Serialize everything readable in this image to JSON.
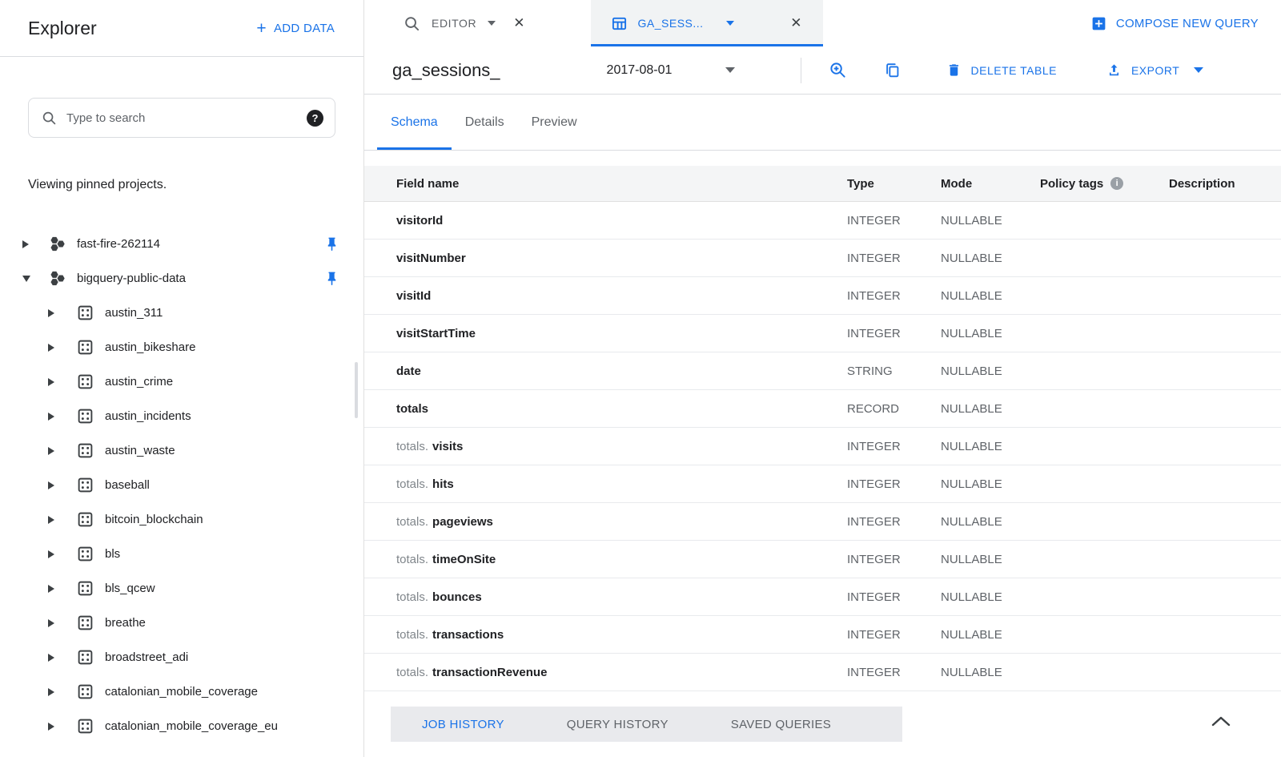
{
  "colors": {
    "accent": "#1a73e8"
  },
  "icons": {
    "add": "+",
    "close": "✕",
    "help": "?",
    "info": "i"
  },
  "explorer": {
    "title": "Explorer",
    "add_data": "ADD DATA",
    "search": {
      "placeholder": "Type to search"
    },
    "pinned_note": "Viewing pinned projects.",
    "projects": [
      {
        "label": "fast-fire-262114",
        "expanded": false,
        "pinned": true,
        "datasets": []
      },
      {
        "label": "bigquery-public-data",
        "expanded": true,
        "pinned": true,
        "datasets": [
          "austin_311",
          "austin_bikeshare",
          "austin_crime",
          "austin_incidents",
          "austin_waste",
          "baseball",
          "bitcoin_blockchain",
          "bls",
          "bls_qcew",
          "breathe",
          "broadstreet_adi",
          "catalonian_mobile_coverage",
          "catalonian_mobile_coverage_eu"
        ]
      }
    ]
  },
  "tab_bar": {
    "editor_tab": {
      "label": "EDITOR"
    },
    "table_tab": {
      "label": "GA_SESS..."
    },
    "compose_button": "COMPOSE NEW QUERY"
  },
  "toolbar": {
    "table_name": "ga_sessions_",
    "table_suffix": "2017-08-01",
    "delete_table": "DELETE TABLE",
    "export": "EXPORT"
  },
  "view_tabs": {
    "labels": [
      "Schema",
      "Details",
      "Preview"
    ],
    "active_index": 0
  },
  "schema": {
    "columns": [
      "Field name",
      "Type",
      "Mode",
      "Policy tags",
      "Description"
    ],
    "rows": [
      {
        "prefix": "",
        "name": "visitorId",
        "type": "INTEGER",
        "mode": "NULLABLE"
      },
      {
        "prefix": "",
        "name": "visitNumber",
        "type": "INTEGER",
        "mode": "NULLABLE"
      },
      {
        "prefix": "",
        "name": "visitId",
        "type": "INTEGER",
        "mode": "NULLABLE"
      },
      {
        "prefix": "",
        "name": "visitStartTime",
        "type": "INTEGER",
        "mode": "NULLABLE"
      },
      {
        "prefix": "",
        "name": "date",
        "type": "STRING",
        "mode": "NULLABLE"
      },
      {
        "prefix": "",
        "name": "totals",
        "type": "RECORD",
        "mode": "NULLABLE"
      },
      {
        "prefix": "totals.",
        "name": "visits",
        "type": "INTEGER",
        "mode": "NULLABLE"
      },
      {
        "prefix": "totals.",
        "name": "hits",
        "type": "INTEGER",
        "mode": "NULLABLE"
      },
      {
        "prefix": "totals.",
        "name": "pageviews",
        "type": "INTEGER",
        "mode": "NULLABLE"
      },
      {
        "prefix": "totals.",
        "name": "timeOnSite",
        "type": "INTEGER",
        "mode": "NULLABLE"
      },
      {
        "prefix": "totals.",
        "name": "bounces",
        "type": "INTEGER",
        "mode": "NULLABLE"
      },
      {
        "prefix": "totals.",
        "name": "transactions",
        "type": "INTEGER",
        "mode": "NULLABLE"
      },
      {
        "prefix": "totals.",
        "name": "transactionRevenue",
        "type": "INTEGER",
        "mode": "NULLABLE"
      }
    ]
  },
  "bottom_bar": {
    "tabs": [
      "JOB HISTORY",
      "QUERY HISTORY",
      "SAVED QUERIES"
    ],
    "active_index": 0
  }
}
